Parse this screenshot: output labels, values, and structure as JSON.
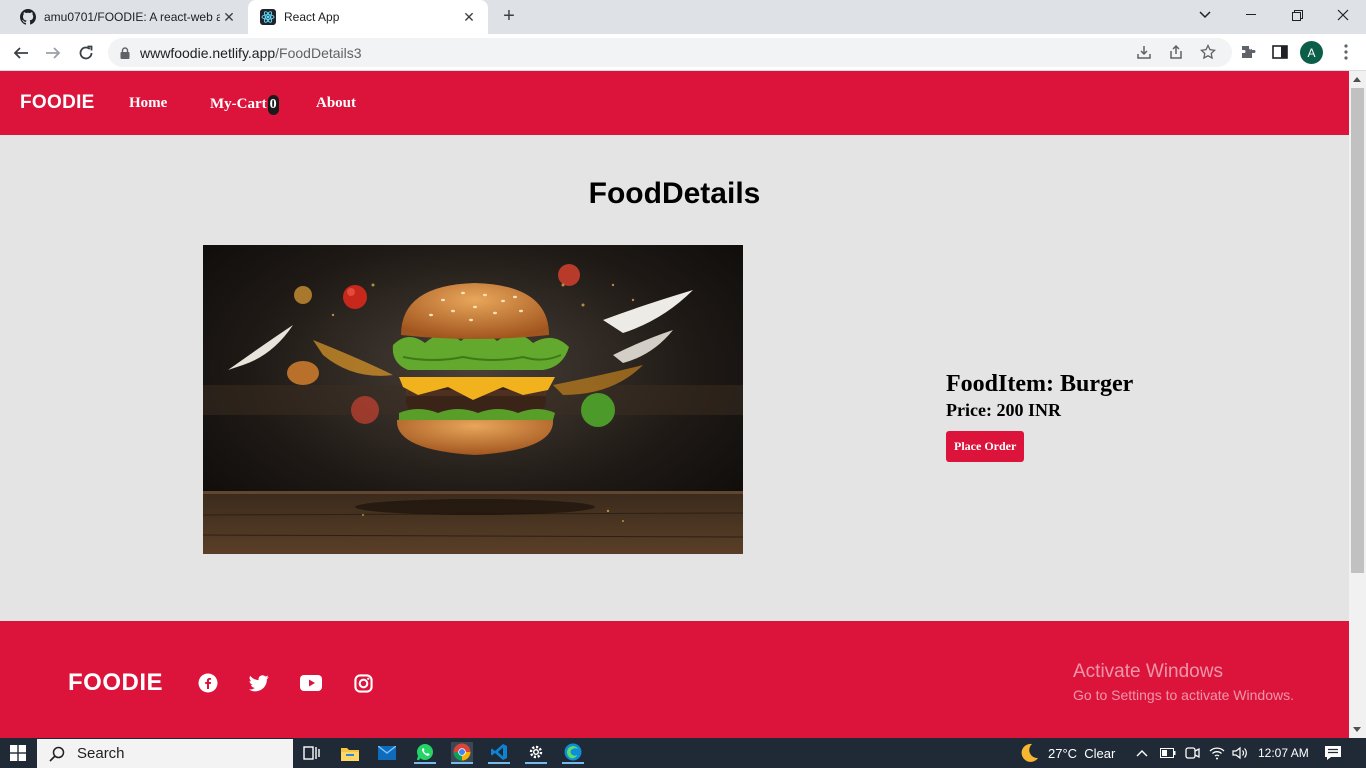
{
  "browser": {
    "tabs": [
      {
        "title": "amu0701/FOODIE: A react-web ap",
        "icon": "github-icon",
        "active": false
      },
      {
        "title": "React App",
        "icon": "react-icon",
        "active": true
      }
    ],
    "url_host": "wwwfoodie.netlify.app",
    "url_path": "/FoodDetails3",
    "profile_initial": "A"
  },
  "navbar": {
    "brand": "FOODIE",
    "links": {
      "home": "Home",
      "cart": "My-Cart",
      "about": "About"
    },
    "cart_count": "0"
  },
  "main": {
    "title": "FoodDetails",
    "image_alt": "burger",
    "food_item_label": "FoodItem: Burger",
    "price_label": "Price: 200 INR",
    "order_button": "Place Order"
  },
  "footer": {
    "brand": "FOODIE",
    "social": [
      "facebook-icon",
      "twitter-icon",
      "youtube-icon",
      "instagram-icon"
    ],
    "watermark_title": "Activate Windows",
    "watermark_sub": "Go to Settings to activate Windows."
  },
  "taskbar": {
    "search_placeholder": "Search",
    "weather": "27°C  Clear",
    "time": "12:07 AM"
  },
  "colors": {
    "brand_red": "#dc143c",
    "page_bg": "#e4e4e4"
  }
}
